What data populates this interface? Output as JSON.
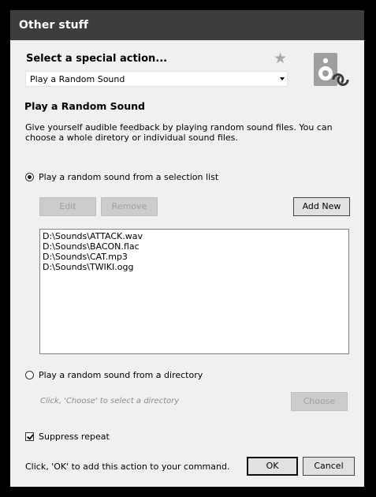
{
  "window": {
    "title": "Other stuff"
  },
  "header": {
    "heading": "Select a special action..."
  },
  "action_combo": {
    "selected": "Play a Random Sound"
  },
  "section": {
    "title": "Play a Random Sound",
    "description": "Give yourself audible feedback by playing random sound files.  You can choose a whole diretory or individual sound files."
  },
  "option_list": {
    "label": "Play a random sound from a selection list",
    "checked": true
  },
  "buttons": {
    "edit": "Edit",
    "remove": "Remove",
    "add_new": "Add New"
  },
  "sound_list": {
    "items": [
      "D:\\Sounds\\ATTACK.wav",
      "D:\\Sounds\\BACON.flac",
      "D:\\Sounds\\CAT.mp3",
      "D:\\Sounds\\TWIKI.ogg"
    ]
  },
  "option_directory": {
    "label": "Play a random sound from a directory",
    "checked": false
  },
  "directory": {
    "hint": "Click, 'Choose' to select a directory",
    "choose": "Choose"
  },
  "suppress": {
    "label": "Suppress repeat",
    "checked": true
  },
  "footer": {
    "hint": "Click, 'OK' to add this action to your command.",
    "ok": "OK",
    "cancel": "Cancel"
  },
  "icons": {
    "star": "star-icon",
    "speaker": "speaker-icon",
    "repeat": "repeat-icon"
  }
}
